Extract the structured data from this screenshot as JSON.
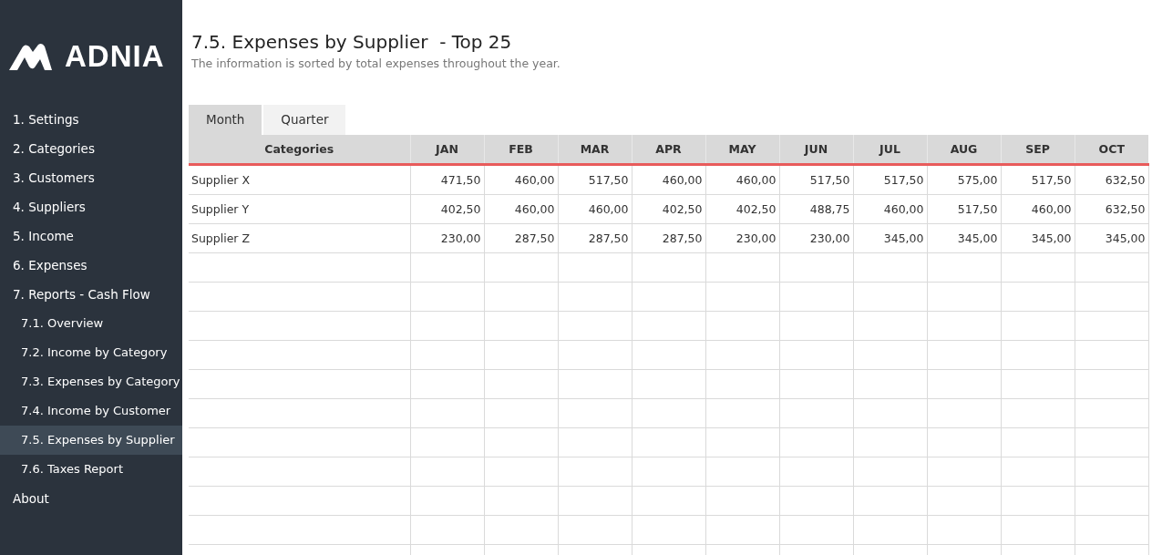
{
  "logo": {
    "text": "ADNIA"
  },
  "sidebar": {
    "items": [
      {
        "label": "1. Settings",
        "selected": false
      },
      {
        "label": "2. Categories",
        "selected": false
      },
      {
        "label": "3. Customers",
        "selected": false
      },
      {
        "label": "4. Suppliers",
        "selected": false
      },
      {
        "label": "5. Income",
        "selected": false
      },
      {
        "label": "6. Expenses",
        "selected": false
      },
      {
        "label": "7. Reports - Cash Flow",
        "selected": false,
        "children": [
          {
            "label": "7.1. Overview",
            "selected": false
          },
          {
            "label": "7.2. Income by Category",
            "selected": false
          },
          {
            "label": "7.3. Expenses by Category",
            "selected": false
          },
          {
            "label": "7.4. Income by Customer",
            "selected": false
          },
          {
            "label": "7.5. Expenses by Supplier",
            "selected": true
          },
          {
            "label": "7.6. Taxes Report",
            "selected": false
          }
        ]
      },
      {
        "label": "About",
        "selected": false
      }
    ]
  },
  "header": {
    "title": "7.5. Expenses by Supplier  - Top 25",
    "subtitle": "The information is sorted by total expenses throughout the year."
  },
  "tabs": [
    {
      "label": "Month",
      "selected": true
    },
    {
      "label": "Quarter",
      "selected": false
    }
  ],
  "table": {
    "columns": [
      "Categories",
      "JAN",
      "FEB",
      "MAR",
      "APR",
      "MAY",
      "JUN",
      "JUL",
      "AUG",
      "SEP",
      "OCT"
    ],
    "rows": [
      [
        "Supplier X",
        "471,50",
        "460,00",
        "517,50",
        "460,00",
        "460,00",
        "517,50",
        "517,50",
        "575,00",
        "517,50",
        "632,50"
      ],
      [
        "Supplier Y",
        "402,50",
        "460,00",
        "460,00",
        "402,50",
        "402,50",
        "488,75",
        "460,00",
        "517,50",
        "460,00",
        "632,50"
      ],
      [
        "Supplier Z",
        "230,00",
        "287,50",
        "287,50",
        "287,50",
        "230,00",
        "230,00",
        "345,00",
        "345,00",
        "345,00",
        "345,00"
      ]
    ]
  }
}
